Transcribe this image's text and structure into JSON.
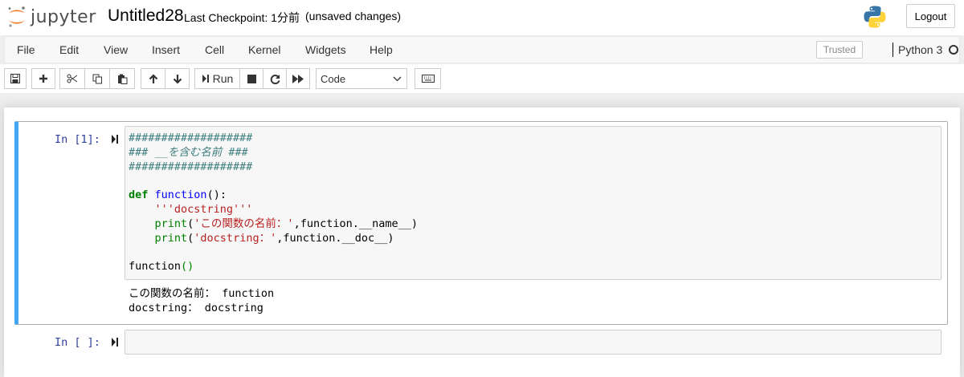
{
  "header": {
    "logo_text": "jupyter",
    "notebook_name": "Untitled28",
    "checkpoint": "Last Checkpoint: 1分前",
    "autosave_status": "(unsaved changes)",
    "logout_label": "Logout"
  },
  "menubar": {
    "items": [
      "File",
      "Edit",
      "View",
      "Insert",
      "Cell",
      "Kernel",
      "Widgets",
      "Help"
    ],
    "trusted_label": "Trusted",
    "kernel_name": "Python 3"
  },
  "toolbar": {
    "buttons": [
      "save-icon",
      "plus-icon",
      "cut-icon",
      "copy-icon",
      "paste-icon",
      "arrow-up-icon",
      "arrow-down-icon",
      "run-icon",
      "stop-icon",
      "restart-icon",
      "fast-forward-icon",
      "keyboard-icon"
    ],
    "run_label": "Run",
    "cell_type": "Code"
  },
  "cells": [
    {
      "prompt": "In [1]:",
      "code_lines": [
        "###################",
        "### __を含む名前 ###",
        "###################",
        "",
        "def function():",
        "    '''docstring'''",
        "    print('この関数の名前：',function.__name__)",
        "    print('docstring：',function.__doc__)",
        "",
        "function()"
      ],
      "output_lines": [
        "この関数の名前： function",
        "docstring： docstring"
      ]
    },
    {
      "prompt": "In [ ]:",
      "code_lines": []
    }
  ],
  "colors": {
    "selected_cell_border": "#42a5f5",
    "prompt": "#303f9f",
    "comment": "#408080",
    "keyword": "#008000",
    "string": "#ba2121",
    "function_def": "#0000ff"
  }
}
